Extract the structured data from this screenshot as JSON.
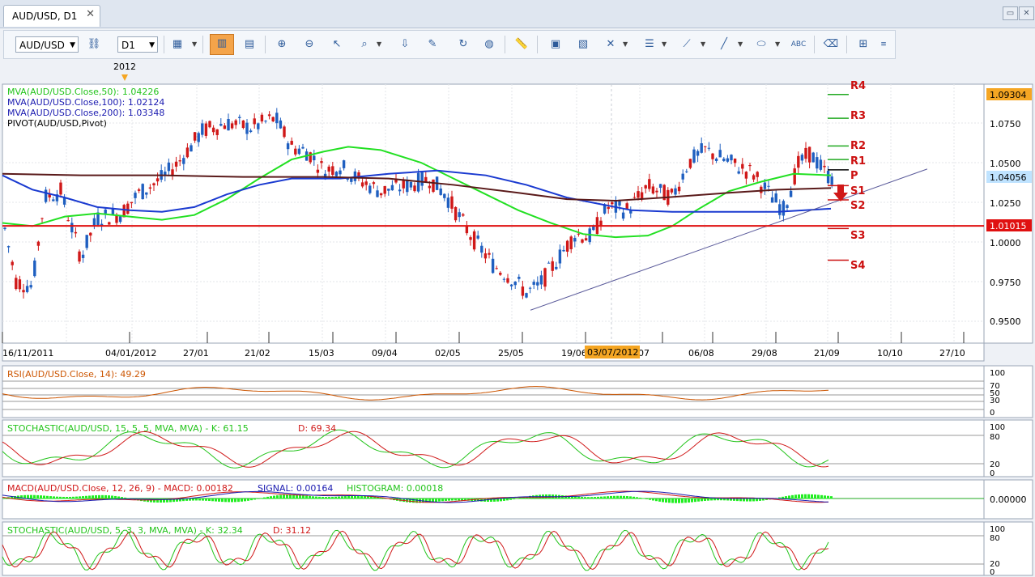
{
  "tab": {
    "title": "AUD/USD, D1",
    "close": "✕"
  },
  "window": {
    "restore": "▭",
    "close": "✕"
  },
  "toolbar": {
    "symbol": "AUD/USD",
    "timeframe": "D1"
  },
  "year_label": "2012",
  "legend": [
    {
      "text": "MVA(AUD/USD.Close,50): 1.04226",
      "color": "#22c41a"
    },
    {
      "text": "MVA(AUD/USD.Close,100): 1.02124",
      "color": "#1a1ab0"
    },
    {
      "text": "MVA(AUD/USD.Close,200): 1.03348",
      "color": "#1a1ab0"
    },
    {
      "text": "PIVOT(AUD/USD,Pivot)",
      "color": "#000000"
    }
  ],
  "price_axis": [
    "1.0750",
    "1.0500",
    "1.0250",
    "1.0000",
    "0.9750",
    "0.9500"
  ],
  "price_markers": [
    {
      "label": "1.09304",
      "bg": "#f5a623"
    },
    {
      "label": "1.04056",
      "bg": "#bfe3ff"
    },
    {
      "label": "1.01015",
      "bg": "#e01010"
    }
  ],
  "pivot_labels": [
    "R4",
    "R3",
    "R2",
    "R1",
    "P",
    "S1",
    "S2",
    "S3",
    "S4"
  ],
  "date_axis": [
    "16/11/2011",
    "04/01/2012",
    "27/01",
    "21/02",
    "15/03",
    "09/04",
    "02/05",
    "25/05",
    "19/06",
    "07",
    "06/08",
    "29/08",
    "21/09",
    "10/10",
    "27/10"
  ],
  "date_highlight": "03/07/2012",
  "indicators": {
    "rsi": {
      "label": "RSI(AUD/USD.Close, 14): 49.29",
      "axis": [
        "100",
        "70",
        "50",
        "30",
        "0"
      ]
    },
    "stoch1": {
      "label": "STOCHASTIC(AUD/USD, 15, 5, 5, MVA, MVA) - K: 61.15",
      "d": "D: 69.34",
      "axis": [
        "100",
        "80",
        "20",
        "0"
      ]
    },
    "macd": {
      "label": "MACD(AUD/USD.Close, 12, 26, 9) - MACD: 0.00182",
      "signal": "SIGNAL: 0.00164",
      "hist": "HISTOGRAM: 0.00018",
      "axis": [
        "0.00000"
      ]
    },
    "stoch2": {
      "label": "STOCHASTIC(AUD/USD, 5, 3, 3, MVA, MVA) - K: 32.34",
      "d": "D: 31.12",
      "axis": [
        "100",
        "80",
        "20",
        "0"
      ]
    }
  },
  "colors": {
    "bull": "#1f5fc0",
    "bear": "#d01818",
    "ma50": "#22e022",
    "ma100": "#1a3ad0",
    "ma200": "#5a1a1a",
    "pivot_r": "#22aa22",
    "pivot_s": "#cc1010"
  }
}
